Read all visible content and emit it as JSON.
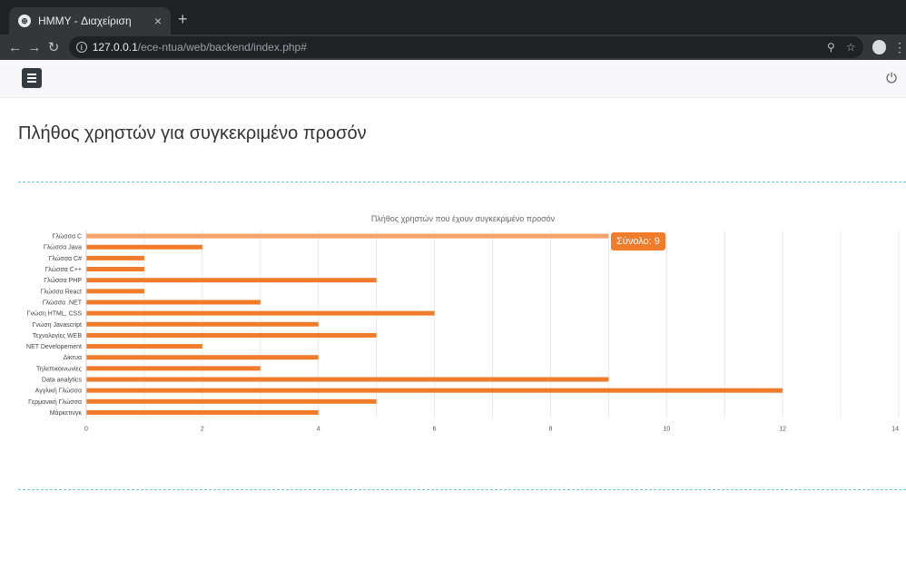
{
  "browser": {
    "tab_title": "HMMY - Διαχείριση",
    "tab_close": "×",
    "new_tab": "+",
    "url_host": "127.0.0.1",
    "url_path": "/ece-ntua/web/backend/index.php#"
  },
  "page": {
    "title": "Πλήθος χρηστών για συγκεκριμένο προσόν"
  },
  "tooltip": {
    "text": "Σύνολο: 9"
  },
  "colors": {
    "bar": "#f07c2b",
    "bar_highlight": "#f6a36a",
    "grid": "#e9e9e9"
  },
  "chart_data": {
    "type": "bar",
    "orientation": "horizontal",
    "title": "Πλήθος χρηστών που έχουν συγκεκριμένο προσόν",
    "categories": [
      "Γλώσσα C",
      "Γλώσσα Java",
      "Γλώσσα C#",
      "Γλώσσα C++",
      "Γλώσσα PHP",
      "Γλώσσα React",
      "Γλώσσα .NET",
      "Γνώση HTML, CSS",
      "Γνώση Javascript",
      "Τεχνολογίες WEB",
      "NET Developement",
      "Δίκτυα",
      "Τηλεπικοινωνίες",
      "Data analytics",
      "Αγγλική Γλώσσα",
      "Γερμανική Γλώσσα",
      "Μάρκετινγκ"
    ],
    "values": [
      9,
      2,
      1,
      1,
      5,
      1,
      3,
      6,
      4,
      5,
      2,
      4,
      3,
      9,
      12,
      5,
      4
    ],
    "xlim": [
      0,
      14
    ],
    "xticks": [
      0,
      2,
      4,
      6,
      8,
      10,
      12,
      14
    ],
    "highlighted_index": 0,
    "grid": true
  }
}
